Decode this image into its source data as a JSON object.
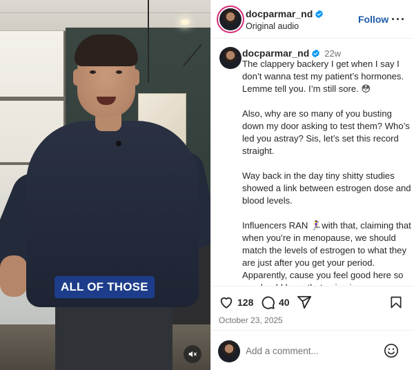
{
  "video": {
    "caption_overlay": "ALL OF THOSE",
    "muted": true
  },
  "header": {
    "username": "docparmar_nd",
    "verified": true,
    "subtitle": "Original audio",
    "follow_label": "Follow",
    "more_label": "···"
  },
  "post": {
    "username": "docparmar_nd",
    "verified": true,
    "time_ago": "22w",
    "caption_paragraphs": [
      "The clappery backery I get when I say I don’t wanna test my patient’s hormones. Lemme tell you. I’m still sore. 😳",
      "Also, why are so many of you busting down my door asking to test them? Who’s led you astray? Sis, let’s set this record straight.",
      "Way back in the day tiny shitty studies showed a link between estrogen dose and blood levels.",
      "Influencers RAN 🏃‍♀️with that, claiming that when you’re in menopause, we should match the levels of estrogen to what they are just after you get your period. Apparently, cause you feel good here so we should keep that going in menopause. Beg your pardon?"
    ]
  },
  "actions": {
    "likes": "128",
    "comments": "40",
    "date": "October 23, 2025"
  },
  "comment_box": {
    "placeholder": "Add a comment..."
  },
  "colors": {
    "follow": "#1c5aa8",
    "verified": "#0095f6",
    "caption_bg": "#1d3d8a",
    "muted_text": "#737373"
  },
  "icons": [
    "verified-badge-icon",
    "more-icon",
    "heart-icon",
    "comment-icon",
    "share-icon",
    "bookmark-icon",
    "emoji-icon",
    "mute-icon"
  ]
}
